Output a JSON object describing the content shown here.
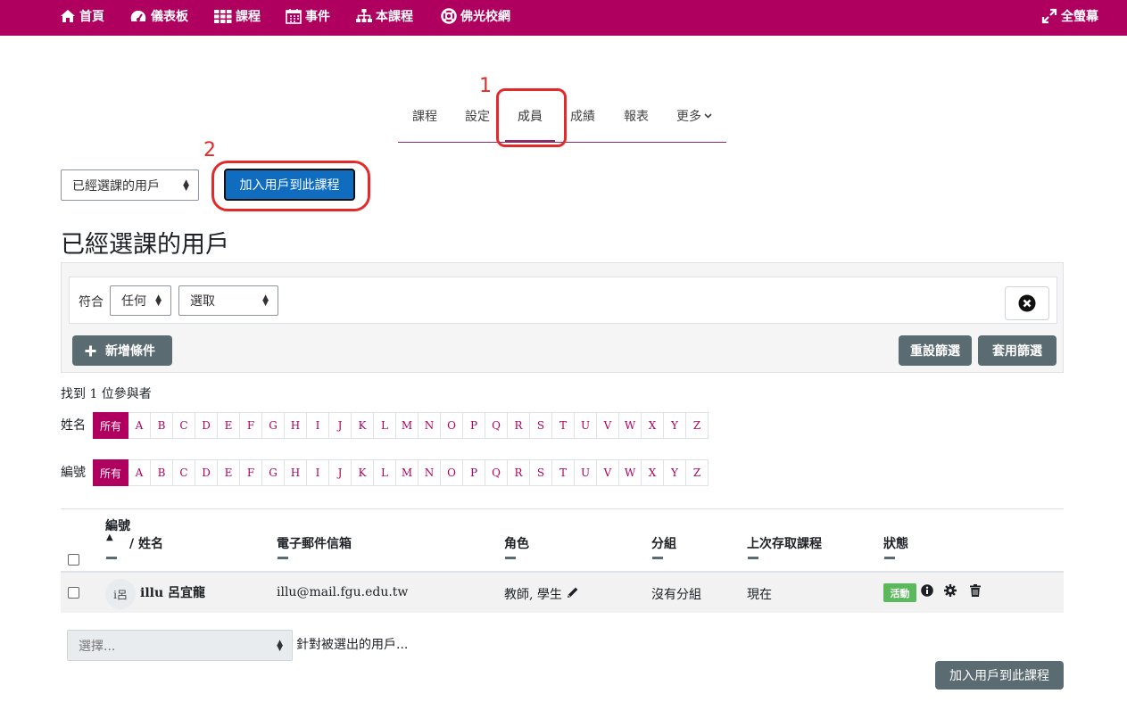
{
  "topnav": {
    "home": "首頁",
    "dashboard": "儀表板",
    "courses": "課程",
    "events": "事件",
    "this_course": "本課程",
    "fgu_net": "佛光校網",
    "fullscreen": "全螢幕"
  },
  "tabs": {
    "course": "課程",
    "settings": "設定",
    "members": "成員",
    "grades": "成績",
    "reports": "報表",
    "more": "更多"
  },
  "annotations": {
    "one": "1",
    "two": "2"
  },
  "enrol": {
    "select_value": "已經選課的用戶",
    "add_button": "加入用戶到此課程"
  },
  "page_title": "已經選課的用戶",
  "filter": {
    "match_label": "符合",
    "any": "任何",
    "choose": "選取",
    "add_condition": "新增條件",
    "reset": "重設篩選",
    "apply": "套用篩選"
  },
  "found_text": "找到 1 位參與者",
  "initials": {
    "firstname_label": "姓名",
    "idnumber_label": "編號",
    "all": "所有",
    "letters": [
      "A",
      "B",
      "C",
      "D",
      "E",
      "F",
      "G",
      "H",
      "I",
      "J",
      "K",
      "L",
      "M",
      "N",
      "O",
      "P",
      "Q",
      "R",
      "S",
      "T",
      "U",
      "V",
      "W",
      "X",
      "Y",
      "Z"
    ]
  },
  "table": {
    "headers": {
      "id": "編號",
      "name": "/ 姓名",
      "email": "電子郵件信箱",
      "roles": "角色",
      "groups": "分組",
      "last_access": "上次存取課程",
      "status": "狀態"
    },
    "rows": [
      {
        "avatar": "i呂",
        "name": "illu 呂宜龍",
        "email": "illu@mail.fgu.edu.tw",
        "roles": "教師, 學生",
        "groups": "沒有分組",
        "last_access": "現在",
        "status": "活動"
      }
    ]
  },
  "bulk": {
    "placeholder": "選擇...",
    "label": "針對被選出的用戶..."
  },
  "bottom_enrol_button": "加入用戶到此課程",
  "colors": {
    "brand": "#b0005f",
    "primary_button": "#0f6cbf",
    "secondary_button": "#5b6b72",
    "annotation": "#e32a2a",
    "status_active": "#5cb85c"
  },
  "icons": {
    "home": "home-icon",
    "dashboard": "dashboard-icon",
    "courses": "grid-icon",
    "events": "calendar-icon",
    "this_course": "sitemap-icon",
    "fgu_net": "lifebuoy-icon",
    "fullscreen": "expand-icon"
  }
}
